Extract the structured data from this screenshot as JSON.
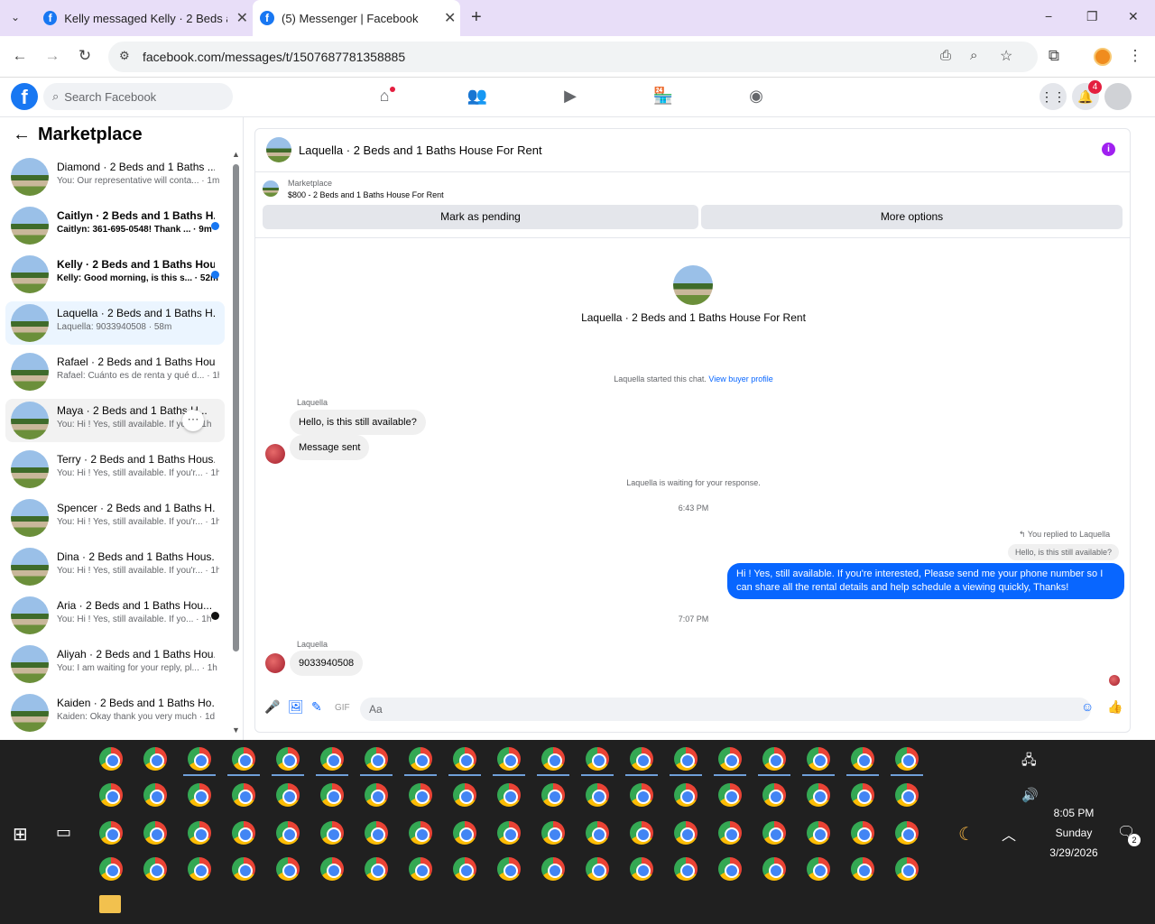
{
  "browser": {
    "tabs": [
      {
        "title": "Kelly messaged Kelly · 2 Beds ar",
        "active": false
      },
      {
        "title": "(5) Messenger | Facebook",
        "active": true
      }
    ],
    "new_tab": "+",
    "url": "facebook.com/messages/t/1507687781358885",
    "window_controls": {
      "minimize": "−",
      "restore": "❐",
      "close": "✕"
    }
  },
  "facebook": {
    "search_placeholder": "Search Facebook",
    "notification_count": "4"
  },
  "sidebar": {
    "title": "Marketplace",
    "conversations": [
      {
        "name": "Diamond · 2 Beds and 1 Baths ...",
        "preview": "You: Our representative will conta... · 1m",
        "unread": false,
        "dot": ""
      },
      {
        "name": "Caitlyn · 2 Beds and 1 Baths H...",
        "preview": "Caitlyn: 361-695-0548! Thank ... · 9m",
        "unread": true,
        "dot": "blue"
      },
      {
        "name": "Kelly · 2 Beds and 1 Baths Hou...",
        "preview": "Kelly: Good morning, is this s... · 52m",
        "unread": true,
        "dot": "blue"
      },
      {
        "name": "Laquella · 2 Beds and 1 Baths H...",
        "preview": "Laquella: 9033940508 · 58m",
        "unread": false,
        "dot": "",
        "selected": true
      },
      {
        "name": "Rafael · 2 Beds and 1 Baths Hou...",
        "preview": "Rafael: Cuánto es de renta y qué d... · 1h",
        "unread": false,
        "dot": ""
      },
      {
        "name": "Maya · 2 Beds and 1 Baths H...",
        "preview": "You: Hi ! Yes, still available. If yo... · 1h",
        "unread": false,
        "dot": "",
        "hover": true
      },
      {
        "name": "Terry · 2 Beds and 1 Baths Hous...",
        "preview": "You: Hi ! Yes, still available. If you'r... · 1h",
        "unread": false,
        "dot": ""
      },
      {
        "name": "Spencer · 2 Beds and 1 Baths H...",
        "preview": "You: Hi ! Yes, still available. If you'r... · 1h",
        "unread": false,
        "dot": ""
      },
      {
        "name": "Dina · 2 Beds and 1 Baths Hous...",
        "preview": "You: Hi ! Yes, still available. If you'r... · 1h",
        "unread": false,
        "dot": ""
      },
      {
        "name": "Aria · 2 Beds and 1 Baths Hou...",
        "preview": "You: Hi ! Yes, still available. If yo... · 1h",
        "unread": false,
        "dot": "dark"
      },
      {
        "name": "Aliyah · 2 Beds and 1 Baths Hou...",
        "preview": "You: I am waiting for your reply, pl... · 1h",
        "unread": false,
        "dot": ""
      },
      {
        "name": "Kaiden · 2 Beds and 1 Baths Ho...",
        "preview": "Kaiden: Okay thank you very much · 1d",
        "unread": false,
        "dot": ""
      }
    ]
  },
  "chat": {
    "header_title": "Laquella · 2 Beds and 1 Baths House For Rent",
    "listing_source": "Marketplace",
    "listing_title": "$800 - 2 Beds and 1 Baths House For Rent",
    "mark_pending": "Mark as pending",
    "more_options": "More options",
    "profile_name": "Laquella · 2 Beds and 1 Baths House For Rent",
    "started_text": "Laquella started this chat.",
    "view_profile": "View buyer profile",
    "sender_label_1": "Laquella",
    "msg_1": "Hello, is this still available?",
    "msg_2": "Message sent",
    "waiting_text": "Laquella is waiting for your response.",
    "time_1": "6:43 PM",
    "replied_label": "You replied to Laquella",
    "quoted": "Hello, is this still available?",
    "my_msg": "Hi ! Yes, still available. If you're interested, Please send me your phone number so I can share all the rental details and help schedule a viewing quickly, Thanks!",
    "time_2": "7:07 PM",
    "sender_label_2": "Laquella",
    "msg_3": "9033940508",
    "input_placeholder": "Aa"
  },
  "taskbar": {
    "time": "8:05 PM",
    "day": "Sunday",
    "date": "3/29/2026",
    "notifications": "2"
  }
}
